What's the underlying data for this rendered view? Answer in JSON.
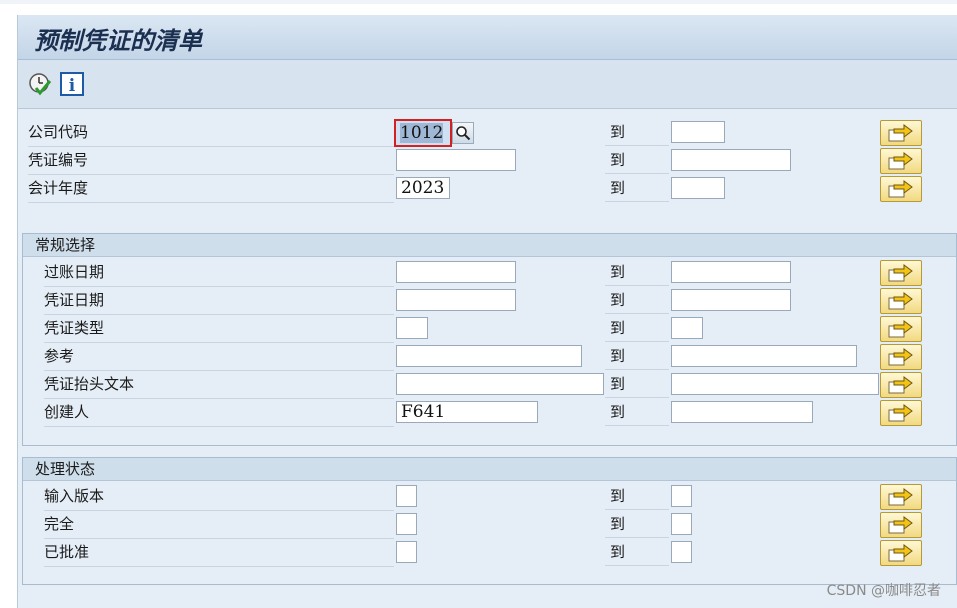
{
  "window": {
    "title": "预制凭证的清单"
  },
  "toolbar": {
    "execute_icon": "clock-check-icon",
    "info_icon": "info-icon",
    "info_glyph": "i"
  },
  "to_label": "到",
  "top_fields": [
    {
      "label": "公司代码",
      "from": "1012",
      "to": ""
    },
    {
      "label": "凭证编号",
      "from": "",
      "to": ""
    },
    {
      "label": "会计年度",
      "from": "2023",
      "to": ""
    }
  ],
  "general_selection": {
    "title": "常规选择",
    "fields": [
      {
        "label": "过账日期",
        "from": "",
        "to": ""
      },
      {
        "label": "凭证日期",
        "from": "",
        "to": ""
      },
      {
        "label": "凭证类型",
        "from": "",
        "to": ""
      },
      {
        "label": "参考",
        "from": "",
        "to": ""
      },
      {
        "label": "凭证抬头文本",
        "from": "",
        "to": ""
      },
      {
        "label": "创建人",
        "from": "F641",
        "to": ""
      }
    ]
  },
  "processing_status": {
    "title": "处理状态",
    "fields": [
      {
        "label": "输入版本",
        "from": "",
        "to": ""
      },
      {
        "label": "完全",
        "from": "",
        "to": ""
      },
      {
        "label": "已批准",
        "from": "",
        "to": ""
      }
    ]
  },
  "watermark": "CSDN @咖啡忍者",
  "colors": {
    "title_text": "#1b3050",
    "panel_bg": "#e5eef6",
    "focus_border": "#d42020",
    "multi_button": "#f2d980"
  }
}
